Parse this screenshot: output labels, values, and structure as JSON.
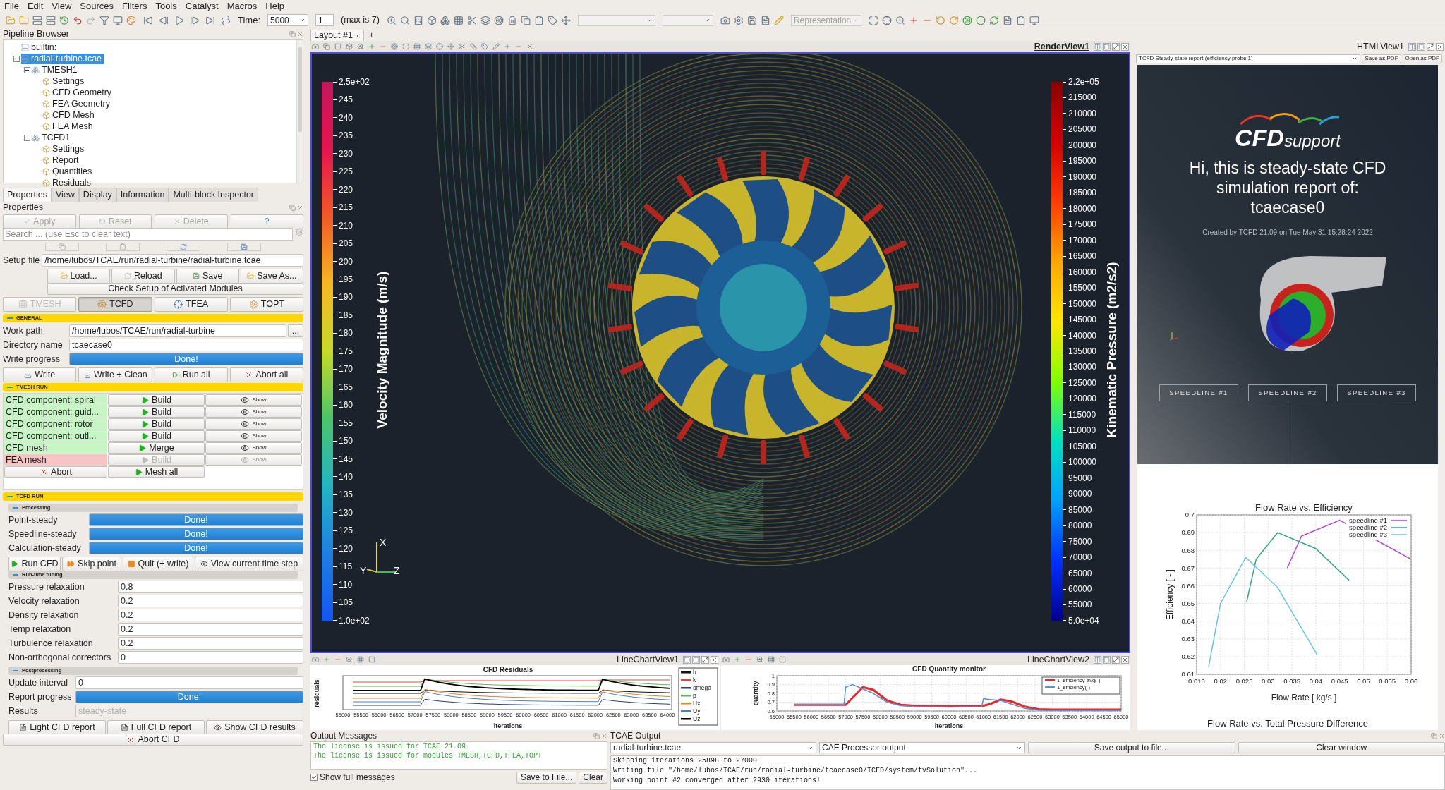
{
  "menu": [
    "File",
    "Edit",
    "View",
    "Sources",
    "Filters",
    "Tools",
    "Catalyst",
    "Macros",
    "Help"
  ],
  "toolbar": {
    "time_label": "Time:",
    "time_value": "5000",
    "step_value": "1",
    "max_note": "(max is 7)",
    "representation": "Representation"
  },
  "pipeline": {
    "title": "Pipeline Browser",
    "tree": [
      {
        "label": "builtin:",
        "selected": false
      },
      {
        "label": "radial-turbine.tcae",
        "selected": true,
        "expanded": true,
        "children": [
          {
            "label": "TMESH1",
            "selected": false,
            "expanded": true,
            "children": [
              {
                "label": "Settings",
                "selected": false
              },
              {
                "label": "CFD Geometry",
                "selected": false
              },
              {
                "label": "FEA Geometry",
                "selected": false
              },
              {
                "label": "CFD Mesh",
                "selected": false
              },
              {
                "label": "FEA Mesh",
                "selected": false
              }
            ]
          },
          {
            "label": "TCFD1",
            "selected": false,
            "expanded": true,
            "children": [
              {
                "label": "Settings",
                "selected": false
              },
              {
                "label": "Report",
                "selected": false
              },
              {
                "label": "Quantities",
                "selected": false
              },
              {
                "label": "Residuals",
                "selected": false
              }
            ]
          }
        ]
      }
    ]
  },
  "panel_tabs": [
    {
      "label": "Properties",
      "selected": true
    },
    {
      "label": "View",
      "selected": false
    },
    {
      "label": "Display",
      "selected": false
    },
    {
      "label": "Information",
      "selected": false
    },
    {
      "label": "Multi-block Inspector",
      "selected": false
    }
  ],
  "properties": {
    "title": "Properties",
    "actions": [
      {
        "label": "Apply",
        "disabled": true
      },
      {
        "label": "Reset",
        "disabled": true
      },
      {
        "label": "Delete",
        "disabled": true
      },
      {
        "label": "?",
        "disabled": false
      }
    ],
    "search_placeholder": "Search ... (use Esc to clear text)",
    "setup_file": {
      "label": "Setup file",
      "value": "/home/lubos/TCAE/run/radial-turbine/radial-turbine.tcae"
    },
    "file_buttons": [
      "Load...",
      "Reload",
      "Save",
      "Save As..."
    ],
    "check_button": "Check Setup of Activated Modules",
    "modules": [
      {
        "label": "TMESH",
        "disabled": true,
        "selected": false
      },
      {
        "label": "TCFD",
        "disabled": false,
        "selected": true
      },
      {
        "label": "TFEA",
        "disabled": false,
        "selected": false
      },
      {
        "label": "TOPT",
        "disabled": false,
        "selected": false
      }
    ],
    "general": {
      "title": "GENERAL",
      "expanded": true,
      "work_path": {
        "label": "Work path",
        "value": "/home/lubos/TCAE/run/radial-turbine",
        "browse": "..."
      },
      "directory": {
        "label": "Directory name",
        "value": "tcaecase0"
      },
      "write_progress": {
        "label": "Write progress",
        "text": "Done!",
        "level": 1
      },
      "buttons": [
        "Write",
        "Write + Clean",
        "Run all",
        "Abort all"
      ]
    },
    "tmesh_run": {
      "title": "TMESH RUN",
      "expanded": true,
      "rows": [
        {
          "label": "CFD component: spiral",
          "done": true,
          "action": "Build",
          "show": "Show",
          "disabled": false
        },
        {
          "label": "CFD component: guid...",
          "done": true,
          "action": "Build",
          "show": "Show",
          "disabled": false
        },
        {
          "label": "CFD component: rotor",
          "done": true,
          "action": "Build",
          "show": "Show",
          "disabled": false
        },
        {
          "label": "CFD component: outl...",
          "done": true,
          "action": "Build",
          "show": "Show",
          "disabled": false
        },
        {
          "label": "CFD mesh",
          "done": true,
          "action": "Merge",
          "show": "Show",
          "disabled": false
        },
        {
          "label": "FEA mesh",
          "done": false,
          "action": "Build",
          "show": "Show",
          "disabled": true
        }
      ],
      "abort": "Abort",
      "mesh_all": "Mesh all"
    },
    "tcfd_run": {
      "title": "TCFD RUN",
      "expanded": true,
      "processing": {
        "title": "Processing",
        "expanded": true,
        "items": [
          {
            "label": "Point-steady",
            "text": "Done!",
            "level": 1
          },
          {
            "label": "Speedline-steady",
            "text": "Done!",
            "level": 1
          },
          {
            "label": "Calculation-steady",
            "text": "Done!",
            "level": 1
          }
        ]
      },
      "run_buttons": [
        "Run CFD",
        "Skip point",
        "Quit (+ write)",
        "View current time step"
      ],
      "tuning": {
        "title": "Run-time tuning",
        "expanded": true,
        "fields": [
          {
            "label": "Pressure relaxation",
            "value": "0.8"
          },
          {
            "label": "Velocity relaxation",
            "value": "0.2"
          },
          {
            "label": "Density relaxation",
            "value": "0.2"
          },
          {
            "label": "Temp relaxation",
            "value": "0.2"
          },
          {
            "label": "Turbulence relaxation",
            "value": "0.2"
          },
          {
            "label": "Non-orthogonal correctors",
            "value": "0"
          }
        ]
      },
      "post": {
        "title": "Postprocessing",
        "expanded": true,
        "update": {
          "label": "Update interval",
          "value": "0"
        },
        "report": {
          "label": "Report progress",
          "text": "Done!",
          "level": 1
        },
        "results": {
          "label": "Results",
          "value": "steady-state",
          "disabled": true
        }
      },
      "report_buttons": [
        "Light CFD report",
        "Full CFD report",
        "Show CFD results"
      ],
      "abort": "Abort CFD"
    }
  },
  "layout_tabs": {
    "tabs": [
      {
        "label": "Layout #1",
        "selected": true
      }
    ],
    "add": "+"
  },
  "render_view": {
    "title": "RenderView1",
    "active": true,
    "legends": [
      {
        "title": "Velocity Magnitude (m/s)",
        "ticks": [
          "2.5e+02",
          "245",
          "240",
          "235",
          "230",
          "225",
          "220",
          "215",
          "210",
          "205",
          "200",
          "195",
          "190",
          "185",
          "180",
          "175",
          "170",
          "165",
          "160",
          "155",
          "150",
          "145",
          "140",
          "135",
          "130",
          "125",
          "120",
          "115",
          "110",
          "105",
          "1.0e+02"
        ]
      },
      {
        "title": "Kinematic Pressure (m2/s2)",
        "ticks": [
          "2.2e+05",
          "215000",
          "210000",
          "205000",
          "200000",
          "195000",
          "190000",
          "185000",
          "180000",
          "175000",
          "170000",
          "165000",
          "160000",
          "155000",
          "150000",
          "145000",
          "140000",
          "135000",
          "130000",
          "125000",
          "120000",
          "115000",
          "110000",
          "105000",
          "100000",
          "95000",
          "90000",
          "85000",
          "80000",
          "75000",
          "70000",
          "65000",
          "60000",
          "55000",
          "5.0e+04"
        ]
      }
    ],
    "axes": [
      "X",
      "Y",
      "Z"
    ]
  },
  "line_charts": [
    {
      "view_title": "LineChartView1",
      "active": false,
      "kind": "residuals",
      "residuals": {
        "title": "CFD Residuals",
        "ylabel": "residuals",
        "xlabel": "iterations",
        "xticks": [
          "55000",
          "55500",
          "56000",
          "56500",
          "57000",
          "57500",
          "58000",
          "58500",
          "59000",
          "59500",
          "60000",
          "60500",
          "61000",
          "61500",
          "62000",
          "62500",
          "63000",
          "63500",
          "64000"
        ],
        "legend": [
          {
            "name": "h",
            "color": "#111111"
          },
          {
            "name": "k",
            "color": "#e0463e"
          },
          {
            "name": "omega",
            "color": "#27407e"
          },
          {
            "name": "p",
            "color": "#5cb85c"
          },
          {
            "name": "Ux",
            "color": "#f07c22"
          },
          {
            "name": "Uy",
            "color": "#4a7fc1"
          },
          {
            "name": "Uz",
            "color": "#000000"
          }
        ]
      }
    },
    {
      "view_title": "LineChartView2",
      "active": false,
      "kind": "monitor",
      "chart_data": {
        "type": "line",
        "grid": true,
        "legend": "upper right",
        "title": "CFD Quantity monitor",
        "xlabel": "iterations",
        "ylabel": "quantity",
        "xlim": [
          55000,
          65000
        ],
        "ylim": [
          0.6,
          1
        ],
        "xticks": [
          55000,
          55500,
          56000,
          56500,
          57000,
          57500,
          58000,
          58500,
          59000,
          59500,
          60000,
          60500,
          61000,
          61500,
          62000,
          62500,
          63000,
          63500,
          64000,
          64500,
          65000
        ],
        "yticks": [
          0.6,
          0.7,
          0.8,
          0.9,
          1
        ],
        "x": [
          55500,
          56500,
          56950,
          57000,
          57200,
          57500,
          57800,
          58200,
          58600,
          59000,
          60000,
          60950,
          61000,
          61200,
          61500,
          61800,
          62200,
          62600,
          63000,
          64000,
          65000
        ],
        "series": [
          {
            "name": "1_efficiency-avg(-)",
            "color": "#e8282b",
            "values": [
              0.67,
              0.67,
              0.67,
              0.67,
              0.75,
              0.87,
              0.84,
              0.72,
              0.67,
              0.66,
              0.655,
              0.655,
              0.66,
              0.68,
              0.73,
              0.71,
              0.65,
              0.62,
              0.615,
              0.615,
              0.615
            ]
          },
          {
            "name": "1_efficiency(-)",
            "color": "#5b8fd0",
            "values": [
              0.675,
              0.675,
              0.675,
              0.87,
              0.9,
              0.85,
              0.8,
              0.7,
              0.66,
              0.65,
              0.645,
              0.648,
              0.74,
              0.73,
              0.72,
              0.68,
              0.63,
              0.61,
              0.607,
              0.607,
              0.607
            ]
          }
        ]
      }
    }
  ],
  "html_view": {
    "title": "HTMLView1",
    "active": false,
    "report_select": "TCFD Steady-state report (efficiency probe 1)",
    "buttons": [
      "Save as PDF",
      "Open as PDF"
    ],
    "logo": {
      "main": "CFD",
      "sub": "support"
    },
    "heading": "Hi, this is steady-state CFD simulation report of:",
    "case_name": "tcaecase0",
    "created": {
      "prefix": "Created by ",
      "link": "TCFD",
      "suffix": " 21.09 on Tue May 31 15:28:24 2022"
    },
    "speedlines": [
      "SPEEDLINE #1",
      "SPEEDLINE #2",
      "SPEEDLINE #3"
    ],
    "chart_data": {
      "type": "line",
      "grid": true,
      "legend": "upper right",
      "title": "Flow Rate vs. Efficiency",
      "xlabel": "Flow Rate [ kg/s ]",
      "ylabel": "Efficiency [ - ]",
      "xlim": [
        0.015,
        0.06
      ],
      "ylim": [
        0.61,
        0.7
      ],
      "xticks": [
        0.015,
        0.02,
        0.025,
        0.03,
        0.035,
        0.04,
        0.045,
        0.05,
        0.055,
        0.06
      ],
      "yticks": [
        0.61,
        0.62,
        0.63,
        0.64,
        0.65,
        0.66,
        0.67,
        0.68,
        0.69,
        0.7
      ],
      "series": [
        {
          "name": "speedline #1",
          "color": "#b23fe0",
          "x": [
            0.034,
            0.037,
            0.045,
            0.06
          ],
          "values": [
            0.67,
            0.688,
            0.697,
            0.675
          ]
        },
        {
          "name": "speedline #2",
          "color": "#2fa87a",
          "x": [
            0.0255,
            0.0275,
            0.032,
            0.04,
            0.047
          ],
          "values": [
            0.651,
            0.675,
            0.69,
            0.681,
            0.663
          ]
        },
        {
          "name": "speedline #3",
          "color": "#6ec3ec",
          "x": [
            0.0175,
            0.02,
            0.0253,
            0.032,
            0.0403
          ],
          "values": [
            0.614,
            0.65,
            0.676,
            0.659,
            0.621
          ]
        }
      ]
    },
    "next_title": "Flow Rate vs. Total Pressure Difference"
  },
  "output_messages": {
    "title": "Output Messages",
    "lines": [
      "The license is issued for TCAE 21.09.",
      "The license is issued for modules TMESH,TCFD,TFEA,TOPT"
    ],
    "show_full": {
      "label": "Show full messages",
      "checked": true
    },
    "buttons": [
      "Save to File...",
      "Clear"
    ]
  },
  "tcae_output": {
    "title": "TCAE Output",
    "source_select": "radial-turbine.tcae",
    "output_select": "CAE Processor output",
    "buttons": [
      "Save output to file...",
      "Clear window"
    ],
    "lines": [
      "Skipping iterations 25898 to 27000",
      "Writing file \"/home/lubos/TCAE/run/radial-turbine/tcaecase0/TCFD/system/fvSolution\"...",
      "Working point #2 converged after 2930 iterations!"
    ]
  }
}
